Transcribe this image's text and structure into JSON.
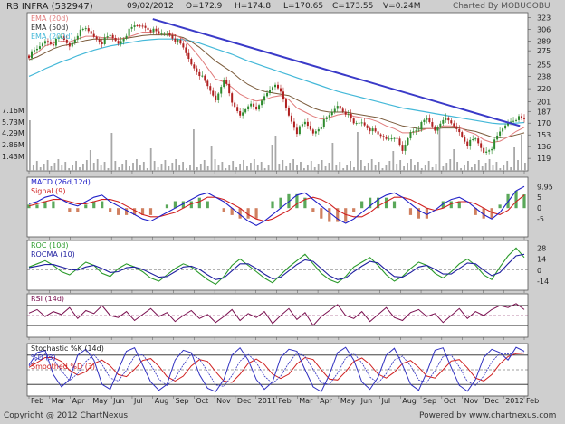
{
  "header": {
    "ticker": "IRB INFRA (532947)",
    "date": "09/02/2012",
    "open": "O=172.9",
    "high": "H=174.8",
    "low": "L=170.65",
    "close": "C=173.55",
    "volume": "V=0.24M",
    "charted_by": "Charted By MOBUGOBU"
  },
  "footer": {
    "copyright": "Copyright @ 2012 ChartNexus",
    "powered": "Powered by www.chartnexus.com"
  },
  "colors": {
    "ema20": "#e07a7a",
    "ema50": "#7a5a3a",
    "ema200": "#44b8d8",
    "trendline": "#3a3ac8",
    "up_candle": "#2e8b2e",
    "down_candle": "#b02020",
    "volume": "#a8a8a8",
    "macd": "#2020c8",
    "signal": "#d02020",
    "roc": "#2a9a2a",
    "rocma": "#2020a0",
    "rsi": "#7a1050",
    "stoch_k": "#3030c0",
    "stoch_d": "#3030c0",
    "stoch_smooth": "#d02020"
  },
  "chart_data": [
    {
      "type": "candlestick",
      "title": "IRB INFRA (532947)",
      "legend": [
        "EMA (20d)",
        "EMA (50d)",
        "EMA (200d)"
      ],
      "legend_position": "top-left",
      "y_ticks": [
        323,
        306,
        289,
        275,
        255,
        238,
        220,
        201,
        187,
        170,
        153,
        136,
        119
      ],
      "ylim": [
        110,
        325
      ],
      "volume_ticks": [
        "7.16M",
        "5.73M",
        "4.29M",
        "2.86M",
        "1.43M"
      ],
      "x_ticks": [
        "Feb",
        "Mar",
        "Apr",
        "May",
        "Jun",
        "Jul",
        "Aug",
        "Sep",
        "Oct",
        "Nov",
        "Dec",
        "2011",
        "Feb",
        "Mar",
        "Apr",
        "May",
        "Jun",
        "Jul",
        "Aug",
        "Sep",
        "Oct",
        "Nov",
        "Dec",
        "2012",
        "Feb"
      ],
      "close_path": [
        268,
        276,
        290,
        286,
        294,
        282,
        300,
        306,
        296,
        288,
        296,
        286,
        300,
        310,
        312,
        306,
        298,
        302,
        292,
        278,
        256,
        242,
        222,
        204,
        236,
        198,
        182,
        198,
        188,
        210,
        226,
        214,
        182,
        158,
        170,
        156,
        168,
        180,
        196,
        186,
        168,
        172,
        162,
        152,
        148,
        152,
        128,
        158,
        164,
        176,
        160,
        178,
        168,
        158,
        140,
        146,
        128,
        136,
        156,
        172,
        178,
        174
      ],
      "ema20": [
        266,
        272,
        282,
        286,
        289,
        288,
        292,
        296,
        296,
        294,
        294,
        292,
        294,
        298,
        302,
        302,
        300,
        300,
        298,
        292,
        280,
        266,
        250,
        234,
        230,
        222,
        212,
        206,
        202,
        204,
        208,
        210,
        204,
        192,
        186,
        180,
        176,
        178,
        182,
        184,
        180,
        178,
        176,
        172,
        166,
        162,
        156,
        156,
        158,
        162,
        162,
        166,
        166,
        164,
        158,
        154,
        146,
        142,
        144,
        150,
        158,
        164
      ],
      "ema50": [
        262,
        266,
        272,
        278,
        282,
        284,
        287,
        290,
        292,
        292,
        292,
        292,
        293,
        295,
        297,
        298,
        298,
        298,
        297,
        294,
        288,
        280,
        270,
        260,
        252,
        244,
        234,
        226,
        220,
        216,
        214,
        212,
        210,
        204,
        198,
        192,
        188,
        186,
        186,
        186,
        184,
        182,
        180,
        178,
        174,
        170,
        166,
        164,
        162,
        162,
        162,
        163,
        163,
        163,
        160,
        158,
        154,
        150,
        149,
        150,
        153,
        156
      ],
      "ema200": [
        238,
        243,
        249,
        254,
        259,
        263,
        268,
        272,
        276,
        279,
        282,
        284,
        286,
        288,
        290,
        291,
        292,
        292,
        292,
        291,
        289,
        286,
        282,
        278,
        274,
        270,
        265,
        260,
        256,
        252,
        248,
        244,
        240,
        236,
        232,
        228,
        224,
        220,
        216,
        213,
        210,
        207,
        204,
        201,
        198,
        195,
        192,
        190,
        188,
        186,
        184,
        182,
        180,
        178,
        176,
        174,
        172,
        170,
        169,
        169,
        170,
        171
      ],
      "trendline": {
        "start": {
          "x": "Aug",
          "y": 321
        },
        "end": {
          "x": "2012",
          "y": 158
        }
      }
    },
    {
      "type": "line",
      "legend": [
        "MACD (26d,12d)",
        "Signal (9)"
      ],
      "legend_position": "top-left",
      "y_ticks": [
        9.95,
        5,
        0,
        -5
      ],
      "ylim": [
        -12,
        13
      ],
      "macd": [
        2,
        3,
        5,
        6,
        4,
        2,
        1,
        3,
        5,
        6,
        3,
        1,
        -1,
        -3,
        -5,
        -6,
        -4,
        -2,
        0,
        2,
        4,
        6,
        7,
        5,
        3,
        0,
        -3,
        -6,
        -8,
        -6,
        -3,
        0,
        3,
        6,
        7,
        4,
        1,
        -2,
        -5,
        -7,
        -5,
        -2,
        1,
        4,
        6,
        7,
        5,
        2,
        -1,
        -3,
        -1,
        2,
        4,
        5,
        3,
        0,
        -3,
        -5,
        -2,
        3,
        8,
        9.95
      ],
      "signal": [
        1,
        2,
        3,
        4,
        4,
        3,
        2,
        2,
        3,
        4,
        4,
        3,
        1,
        -1,
        -3,
        -4,
        -4,
        -3,
        -2,
        0,
        2,
        3,
        5,
        5,
        4,
        2,
        0,
        -3,
        -5,
        -6,
        -5,
        -3,
        -1,
        2,
        4,
        5,
        4,
        2,
        -1,
        -3,
        -4,
        -4,
        -2,
        1,
        3,
        5,
        5,
        4,
        2,
        0,
        -1,
        0,
        2,
        3,
        3,
        2,
        0,
        -2,
        -3,
        -1,
        3,
        6
      ]
    },
    {
      "type": "line",
      "legend": [
        "ROC (10d)",
        "ROCMA (10)"
      ],
      "legend_position": "top-left",
      "y_ticks": [
        28,
        14,
        0,
        -14
      ],
      "ylim": [
        -22,
        34
      ],
      "roc": [
        4,
        8,
        12,
        6,
        -2,
        -6,
        2,
        10,
        6,
        -4,
        -8,
        2,
        8,
        4,
        -2,
        -10,
        -14,
        -6,
        2,
        8,
        4,
        -4,
        -12,
        -18,
        -8,
        6,
        14,
        6,
        -2,
        -10,
        -16,
        -6,
        4,
        12,
        20,
        8,
        -4,
        -12,
        -16,
        -8,
        4,
        10,
        16,
        6,
        -6,
        -14,
        -8,
        2,
        10,
        6,
        -4,
        -10,
        -2,
        8,
        14,
        6,
        -6,
        -12,
        4,
        18,
        28,
        16
      ],
      "rocma": [
        3,
        5,
        7,
        7,
        4,
        1,
        0,
        4,
        6,
        2,
        -3,
        -2,
        3,
        4,
        1,
        -4,
        -9,
        -8,
        -2,
        4,
        5,
        1,
        -6,
        -12,
        -10,
        -1,
        8,
        8,
        2,
        -5,
        -11,
        -9,
        -1,
        7,
        13,
        11,
        2,
        -7,
        -12,
        -10,
        -2,
        5,
        11,
        9,
        0,
        -8,
        -9,
        -3,
        4,
        6,
        1,
        -5,
        -5,
        2,
        9,
        8,
        0,
        -7,
        -3,
        8,
        18,
        20
      ]
    },
    {
      "type": "line",
      "legend": [
        "RSI (14d)"
      ],
      "legend_position": "top-left",
      "ylim": [
        10,
        90
      ],
      "guides": [
        70,
        50,
        30
      ],
      "rsi": [
        55,
        62,
        48,
        58,
        52,
        66,
        44,
        60,
        54,
        70,
        50,
        46,
        58,
        40,
        52,
        64,
        48,
        56,
        38,
        50,
        60,
        44,
        52,
        36,
        48,
        62,
        40,
        54,
        46,
        58,
        34,
        50,
        64,
        42,
        56,
        30,
        48,
        60,
        72,
        50,
        44,
        58,
        38,
        52,
        66,
        46,
        40,
        56,
        62,
        48,
        54,
        36,
        50,
        64,
        44,
        58,
        50,
        62,
        70,
        66,
        74,
        62
      ]
    },
    {
      "type": "line",
      "legend": [
        "Stochastic %K (14d)",
        "%D (3)",
        "Smoothed %D (3)"
      ],
      "legend_position": "top-left",
      "ylim": [
        0,
        100
      ],
      "guides": [
        80,
        50,
        20
      ],
      "stoch_k": [
        60,
        85,
        90,
        40,
        15,
        30,
        80,
        92,
        70,
        20,
        10,
        50,
        88,
        95,
        60,
        25,
        8,
        20,
        70,
        90,
        85,
        40,
        12,
        5,
        30,
        80,
        95,
        70,
        30,
        10,
        25,
        75,
        92,
        88,
        50,
        15,
        5,
        40,
        85,
        96,
        70,
        25,
        10,
        35,
        80,
        94,
        60,
        20,
        8,
        45,
        90,
        95,
        55,
        18,
        6,
        30,
        75,
        92,
        85,
        70,
        96,
        88
      ],
      "stoch_d": [
        58,
        72,
        82,
        72,
        48,
        28,
        42,
        67,
        81,
        61,
        33,
        27,
        49,
        78,
        81,
        60,
        31,
        18,
        33,
        60,
        82,
        72,
        46,
        19,
        16,
        38,
        68,
        82,
        65,
        37,
        22,
        37,
        64,
        85,
        77,
        51,
        23,
        20,
        43,
        74,
        84,
        64,
        35,
        23,
        42,
        70,
        78,
        58,
        29,
        24,
        48,
        77,
        80,
        56,
        26,
        18,
        37,
        66,
        84,
        82,
        84,
        85
      ],
      "smoothed_d": [
        55,
        65,
        75,
        75,
        67,
        49,
        39,
        46,
        63,
        70,
        58,
        40,
        36,
        51,
        69,
        73,
        57,
        36,
        27,
        37,
        58,
        71,
        67,
        46,
        27,
        24,
        41,
        63,
        72,
        61,
        41,
        32,
        41,
        62,
        75,
        71,
        50,
        31,
        29,
        46,
        67,
        74,
        61,
        41,
        33,
        45,
        63,
        69,
        55,
        37,
        33,
        50,
        68,
        71,
        54,
        33,
        27,
        40,
        62,
        77,
        83,
        84
      ]
    }
  ]
}
